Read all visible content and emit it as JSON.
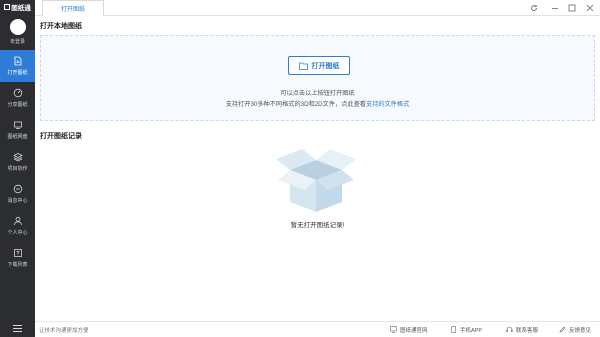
{
  "app": {
    "logo_text": "图纸通"
  },
  "user": {
    "status_label": "未登录"
  },
  "sidebar": {
    "items": [
      {
        "label": "打开图纸",
        "icon": "document-icon",
        "active": true
      },
      {
        "label": "分享图纸",
        "icon": "share-icon",
        "active": false
      },
      {
        "label": "图纸网盘",
        "icon": "cloud-drive-icon",
        "active": false
      },
      {
        "label": "项目协作",
        "icon": "layers-icon",
        "active": false
      },
      {
        "label": "消息中心",
        "icon": "message-icon",
        "active": false
      },
      {
        "label": "个人中心",
        "icon": "person-icon",
        "active": false
      },
      {
        "label": "下载列表",
        "icon": "download-list-icon",
        "active": false
      }
    ],
    "menu_icon": "hamburger-icon"
  },
  "titlebar": {
    "active_tab": "打开图纸",
    "controls": [
      "refresh-icon",
      "minimize-icon",
      "maximize-icon",
      "close-icon"
    ]
  },
  "local": {
    "section_title": "打开本地图纸",
    "open_button_label": "打开图纸",
    "hint_line1": "可以点击以上按钮打开图纸",
    "hint_line2_prefix": "支持打开30多种不同格式的3D和2D文件，点此查看",
    "hint_line2_link": "支持的文件格式"
  },
  "records": {
    "section_title": "打开图纸记录",
    "empty_text": "暂无打开图纸记录!"
  },
  "statusbar": {
    "left_text": "让技术沟通更加方便",
    "links": [
      {
        "label": "图纸通官网",
        "icon": "monitor-icon"
      },
      {
        "label": "手机APP",
        "icon": "phone-icon"
      },
      {
        "label": "联系客服",
        "icon": "headset-icon"
      },
      {
        "label": "反馈意见",
        "icon": "feedback-icon"
      }
    ]
  },
  "colors": {
    "accent": "#2f7bd8",
    "sidebar_bg": "#2b2d30",
    "dropzone_bg": "#f6f9fd",
    "box_fill": "#cfe0ec"
  }
}
